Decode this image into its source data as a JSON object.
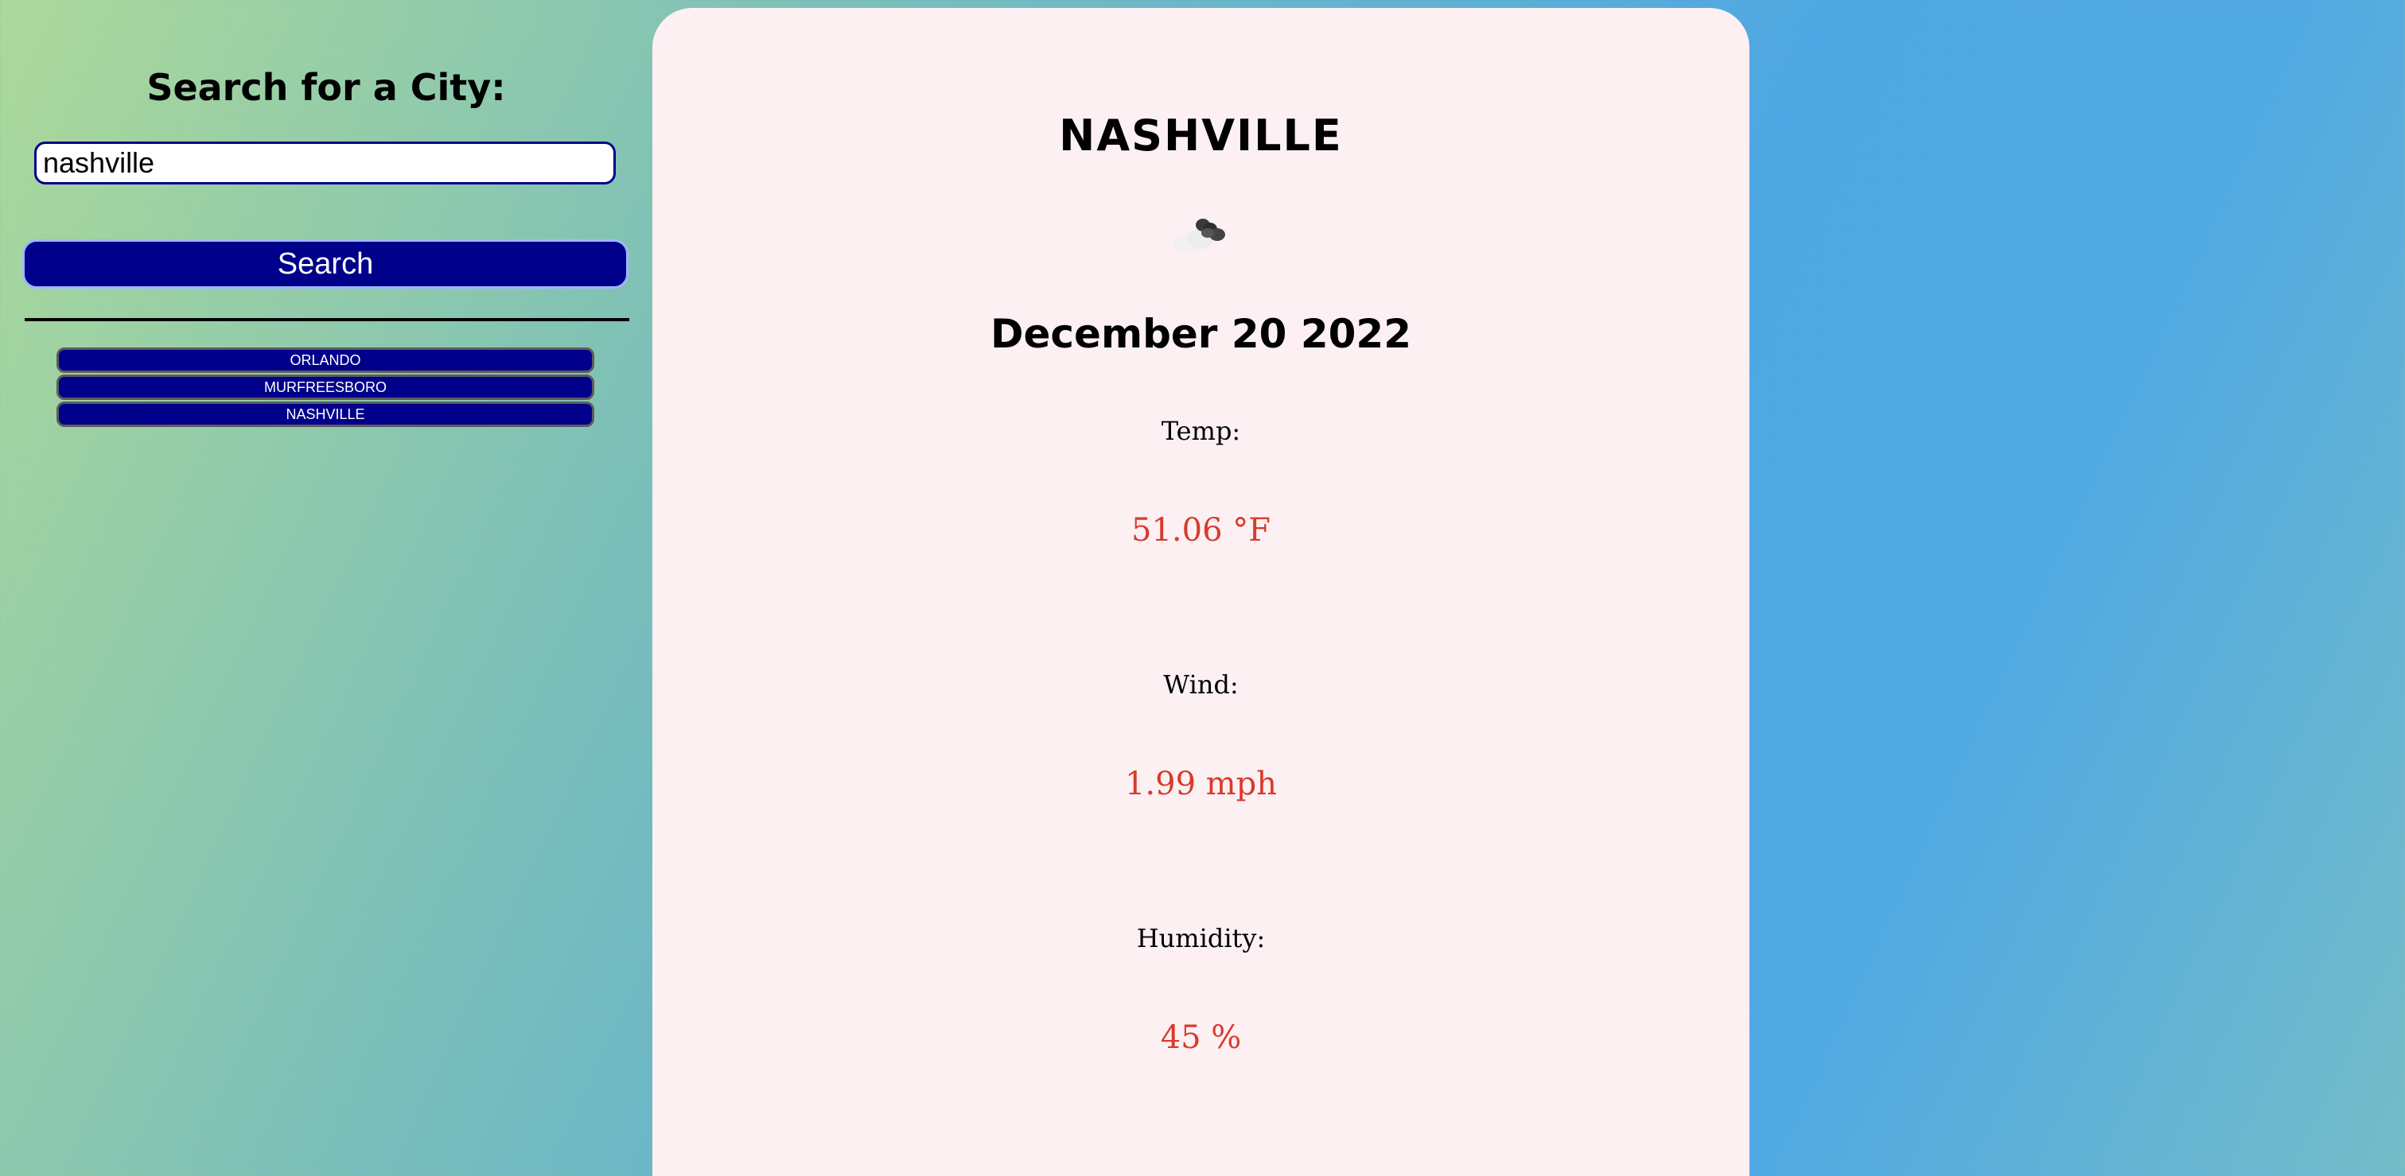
{
  "sidebar": {
    "title": "Search for a City:",
    "search_value": "nashville",
    "search_button_label": "Search",
    "history": [
      {
        "label": "ORLANDO"
      },
      {
        "label": "MURFREESBORO"
      },
      {
        "label": "NASHVILLE"
      }
    ]
  },
  "weather": {
    "city": "NASHVILLE",
    "icon": "cloud-icon",
    "date": "December 20 2022",
    "temp_label": "Temp:",
    "temp_value": "51.06 °F",
    "wind_label": "Wind:",
    "wind_value": "1.99 mph",
    "humidity_label": "Humidity:",
    "humidity_value": "45 %"
  },
  "colors": {
    "accent": "#00008b",
    "value_red": "#d93a2b",
    "card_bg": "#fcf0f3"
  }
}
